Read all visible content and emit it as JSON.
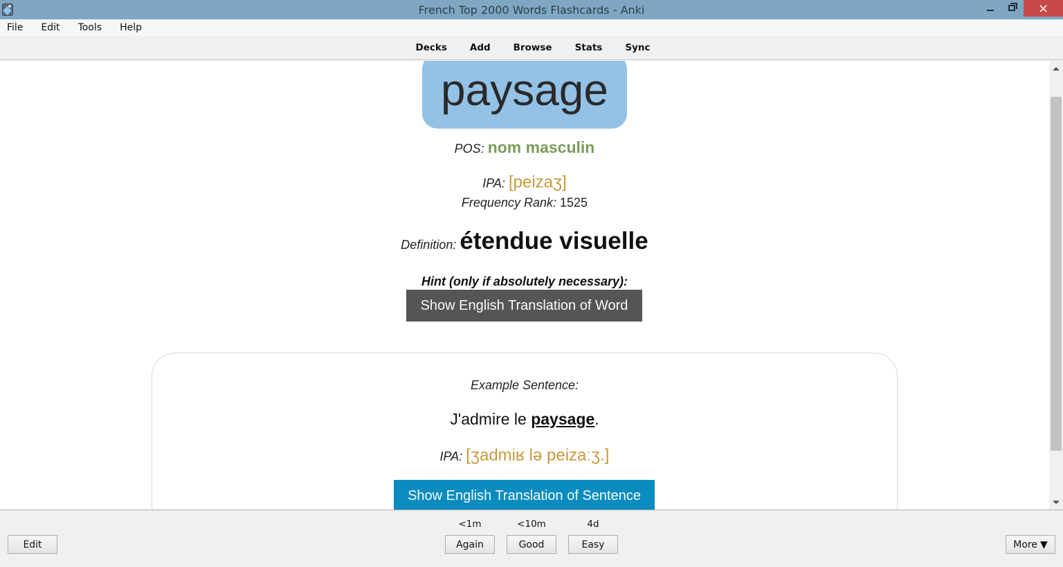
{
  "window": {
    "title": "French Top 2000 Words Flashcards - Anki",
    "app_icon": "anki-icon",
    "controls": {
      "minimize": "minimize-icon",
      "maximize": "restore-icon",
      "close": "×"
    }
  },
  "menu": {
    "items": [
      "File",
      "Edit",
      "Tools",
      "Help"
    ]
  },
  "toolbar": {
    "links": [
      "Decks",
      "Add",
      "Browse",
      "Stats",
      "Sync"
    ]
  },
  "card": {
    "word": "paysage",
    "pos_label": "POS:",
    "pos_value": "nom masculin",
    "ipa_label": "IPA:",
    "ipa_value": "[peizaʒ]",
    "freq_label": "Frequency Rank:",
    "freq_value": "1525",
    "definition_label": "Definition:",
    "definition_value": "étendue visuelle",
    "hint_label": "Hint (only if absolutely necessary):",
    "show_word_translation": "Show English Translation of Word",
    "example": {
      "label": "Example Sentence:",
      "sentence_before": "J'admire le ",
      "sentence_highlight": "paysage",
      "sentence_after": ".",
      "ipa_label": "IPA:",
      "ipa_value": "[ʒadmiʁ lə peizaːʒ.]",
      "show_sentence_translation": "Show English Translation of Sentence"
    },
    "colors": {
      "word_box": "#93c2e6",
      "pos": "#7a9a5a",
      "ipa": "#c59a3d",
      "word_button": "#555555",
      "sentence_button": "#0a8cbf"
    }
  },
  "scrollbar": {
    "position_fraction": 0.08
  },
  "bottom": {
    "edit": "Edit",
    "answers": [
      {
        "label": "Again",
        "interval": "<1m"
      },
      {
        "label": "Good",
        "interval": "<10m"
      },
      {
        "label": "Easy",
        "interval": "4d"
      }
    ],
    "more": "More",
    "more_arrow": "▼"
  }
}
